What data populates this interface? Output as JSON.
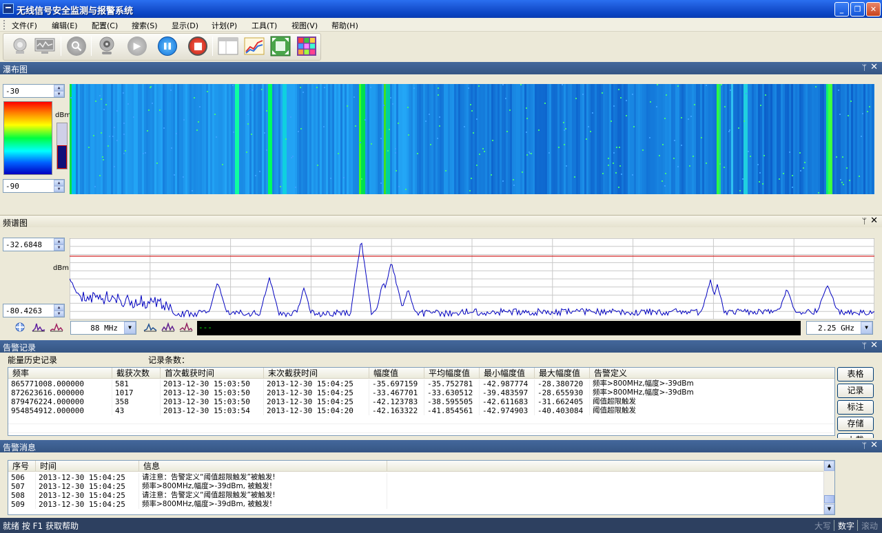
{
  "window": {
    "title": "无线信号安全监测与报警系统",
    "minimize": "_",
    "restore": "❐",
    "close": "✕"
  },
  "menu": [
    "文件(F)",
    "编辑(E)",
    "配置(C)",
    "搜索(S)",
    "显示(D)",
    "计划(P)",
    "工具(T)",
    "视图(V)",
    "帮助(H)"
  ],
  "toolbar": {
    "icons": [
      "antenna-icon",
      "monitor-icon",
      "search-icon",
      "webcam-icon",
      "play-icon",
      "pause-icon",
      "stop-icon",
      "window-icon",
      "chart-icon",
      "fit-icon",
      "palette-icon"
    ]
  },
  "waterfall": {
    "title": "瀑布图",
    "max": "-30",
    "min": "-90",
    "unit": "dBm"
  },
  "spectrum": {
    "title": "频谱图",
    "max": "-32.6848",
    "min": "-80.4263",
    "unit": "dBm",
    "start_freq": "88 MHz",
    "end_freq": "2.25 GHz",
    "marker_text": "---"
  },
  "alarm_records": {
    "title": "告警记录",
    "tab_label": "能量历史记录",
    "count_label": "记录条数：",
    "columns": [
      "频率",
      "截获次数",
      "首次截获时间",
      "末次截获时间",
      "幅度值",
      "平均幅度值",
      "最小幅度值",
      "最大幅度值",
      "告警定义"
    ],
    "rows": [
      [
        "865771008.000000",
        "581",
        "2013-12-30 15:03:50",
        "2013-12-30 15:04:25",
        "-35.697159",
        "-35.752781",
        "-42.987774",
        "-28.380720",
        "频率>800MHz,幅度>-39dBm"
      ],
      [
        "872623616.000000",
        "1017",
        "2013-12-30 15:03:50",
        "2013-12-30 15:04:25",
        "-33.467701",
        "-33.630512",
        "-39.483597",
        "-28.655930",
        "频率>800MHz,幅度>-39dBm"
      ],
      [
        "879476224.000000",
        "358",
        "2013-12-30 15:03:50",
        "2013-12-30 15:04:25",
        "-42.123783",
        "-38.595505",
        "-42.611683",
        "-31.662405",
        "阈值超限触发"
      ],
      [
        "954854912.000000",
        "43",
        "2013-12-30 15:03:54",
        "2013-12-30 15:04:20",
        "-42.163322",
        "-41.854561",
        "-42.974903",
        "-40.403084",
        "阈值超限触发"
      ]
    ],
    "buttons": [
      "表格",
      "记录",
      "标注",
      "存储",
      "上载"
    ]
  },
  "alarm_messages": {
    "title": "告警消息",
    "columns": [
      "序号",
      "时间",
      "信息"
    ],
    "rows": [
      [
        "506",
        "2013-12-30 15:04:25",
        "请注意：告警定义“阈值超限触发”被触发!"
      ],
      [
        "507",
        "2013-12-30 15:04:25",
        "频率>800MHz,幅度>-39dBm, 被触发!"
      ],
      [
        "508",
        "2013-12-30 15:04:25",
        "请注意：告警定义“阈值超限触发”被触发!"
      ],
      [
        "509",
        "2013-12-30 15:04:25",
        "频率>800MHz,幅度>-39dBm, 被触发!"
      ]
    ]
  },
  "statusbar": {
    "text": "就绪 按 F1 获取帮助",
    "caps": "大写",
    "num": "数字",
    "scroll": "滚动"
  }
}
